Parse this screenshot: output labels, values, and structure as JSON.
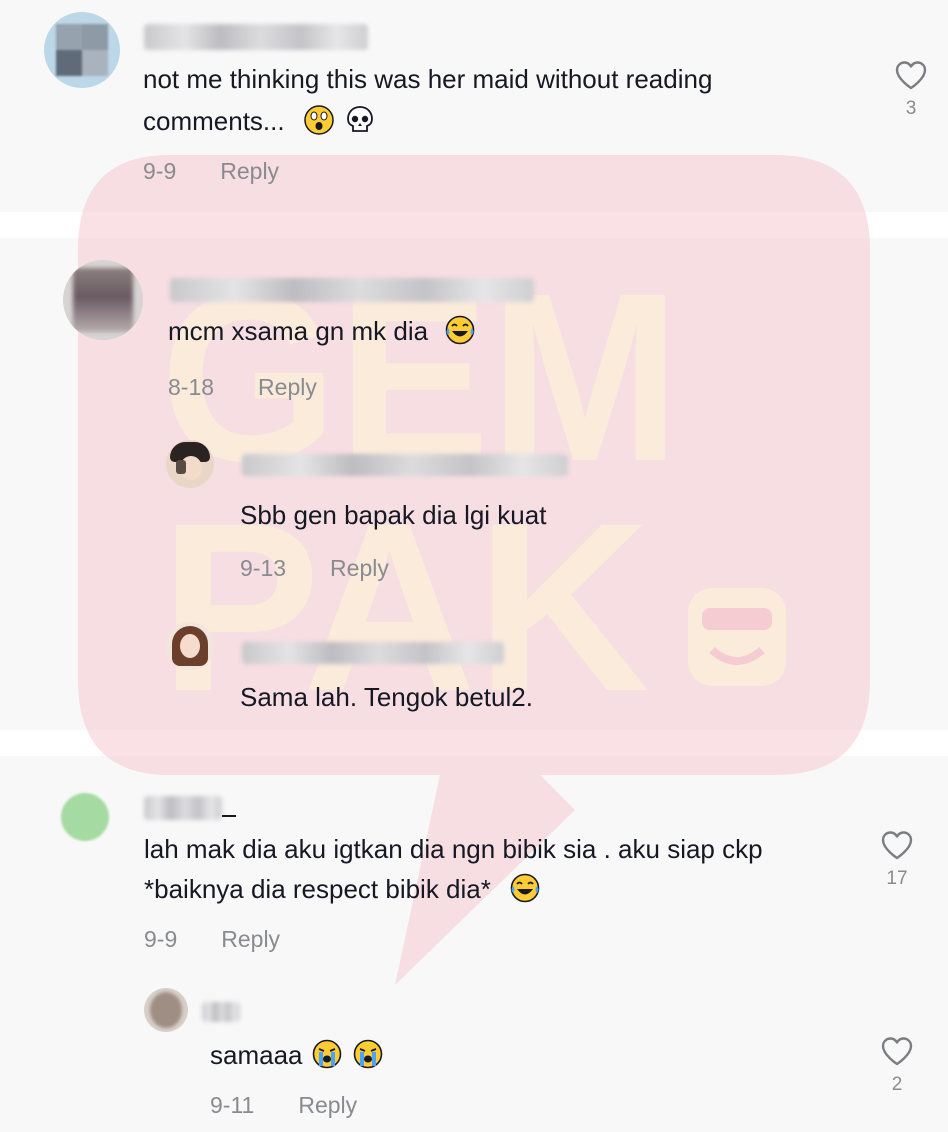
{
  "comments": [
    {
      "text_line1": "not me thinking this was her maid without reading",
      "text_line2": "comments...",
      "emojis": [
        "shocked-face-emoji",
        "skull-emoji"
      ],
      "date": "9-9",
      "reply_label": "Reply",
      "likes": "3"
    },
    {
      "text": "mcm xsama gn mk dia",
      "emojis": [
        "laughing-tears-emoji"
      ],
      "date": "8-18",
      "reply_label": "Reply",
      "replies": [
        {
          "text": "Sbb gen bapak dia lgi kuat",
          "date": "9-13",
          "reply_label": "Reply"
        },
        {
          "text": "Sama lah. Tengok betul2."
        }
      ]
    },
    {
      "text_line1": "lah mak dia aku igtkan dia ngn bibik sia . aku siap ckp",
      "text_line2": "*baiknya dia respect bibik dia*",
      "emojis": [
        "laughing-tears-emoji"
      ],
      "date": "9-9",
      "reply_label": "Reply",
      "likes": "17",
      "replies": [
        {
          "text": "samaaa",
          "emojis": [
            "loudly-crying-emoji",
            "loudly-crying-emoji"
          ],
          "date": "9-11",
          "reply_label": "Reply",
          "likes": "2"
        }
      ]
    }
  ],
  "watermark": {
    "brand_top": "GEM",
    "brand_bottom": "PAK",
    "color": "#f4c9cf",
    "letter_color": "#fbeeda"
  },
  "colors": {
    "text": "#161823",
    "meta": "#8a8b91",
    "background": "#f8f8f8",
    "separator": "#ffffff"
  }
}
